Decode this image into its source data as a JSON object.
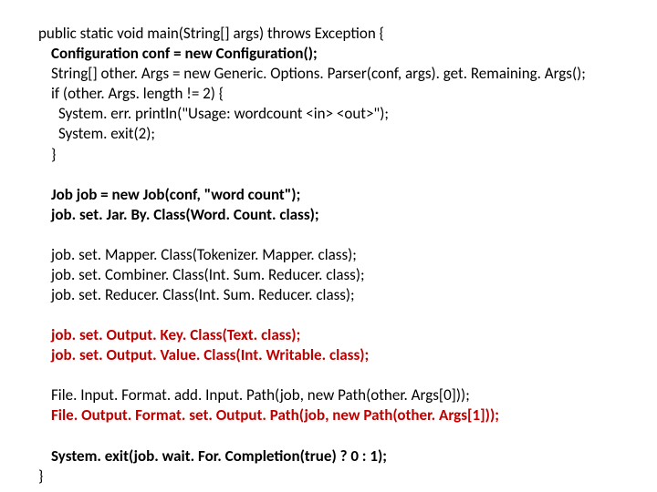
{
  "code": {
    "l1": "public static void main(String[] args) throws Exception {",
    "l2": "Configuration conf = new Configuration();",
    "l3": "String[] other. Args = new Generic. Options. Parser(conf, args). get. Remaining. Args();",
    "l4": "if (other. Args. length != 2) {",
    "l5": "System. err. println(\"Usage: wordcount <in> <out>\");",
    "l6": "System. exit(2);",
    "l7": "}",
    "l8": "Job job = new Job(conf, \"word count\");",
    "l9": "job. set. Jar. By. Class(Word. Count. class);",
    "l10": "job. set. Mapper. Class(Tokenizer. Mapper. class);",
    "l11": "job. set. Combiner. Class(Int. Sum. Reducer. class);",
    "l12": "job. set. Reducer. Class(Int. Sum. Reducer. class);",
    "l13": "job. set. Output. Key. Class(Text. class);",
    "l14": "job. set. Output. Value. Class(Int. Writable. class);",
    "l15": "File. Input. Format. add. Input. Path(job, new Path(other. Args[0]));",
    "l16": "File. Output. Format. set. Output. Path(job, new Path(other. Args[1]));",
    "l17": "System. exit(job. wait. For. Completion(true) ? 0 : 1);",
    "l18": "}"
  }
}
